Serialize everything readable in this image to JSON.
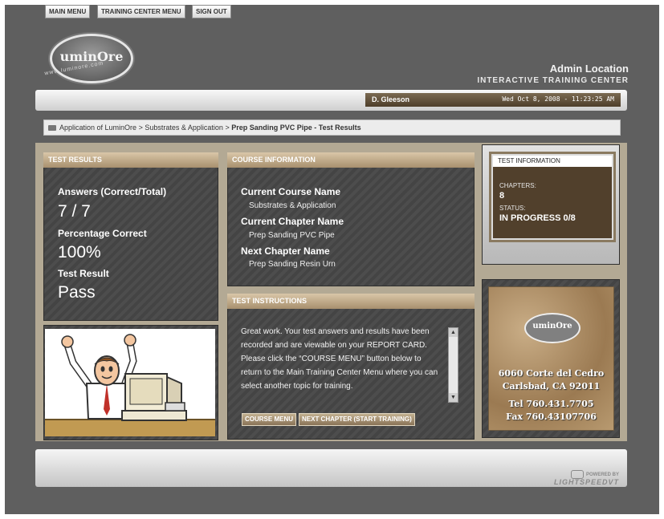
{
  "header": {
    "logo_text": "uminOre",
    "logo_url": "www.luminore.com",
    "location": "Admin Location",
    "subtitle": "INTERACTIVE TRAINING CENTER"
  },
  "nav": {
    "buttons": [
      "MAIN MENU",
      "TRAINING CENTER MENU",
      "SIGN OUT"
    ]
  },
  "user": {
    "name": "D. Gleeson",
    "datetime": "Wed Oct 8, 2008 - 11:23:25 AM"
  },
  "breadcrumb": {
    "part1": "Application of LuminOre",
    "part2": "Substrates & Application",
    "current": "Prep Sanding PVC Pipe - Test Results",
    "separator": ">"
  },
  "test_results": {
    "header": "TEST RESULTS",
    "answers_label": "Answers (Correct/Total)",
    "answers_value": "7 / 7",
    "percentage_label": "Percentage Correct",
    "percentage_value": "100%",
    "result_label": "Test Result",
    "result_value": "Pass"
  },
  "course_info": {
    "header": "COURSE INFORMATION",
    "current_course_label": "Current Course Name",
    "current_course_value": "Substrates & Application",
    "current_chapter_label": "Current Chapter Name",
    "current_chapter_value": "Prep Sanding PVC Pipe",
    "next_chapter_label": "Next Chapter Name",
    "next_chapter_value": "Prep Sanding Resin Urn"
  },
  "test_info": {
    "title": "TEST INFORMATION",
    "chapters_label": "CHAPTERS:",
    "chapters_value": "8",
    "status_label": "STATUS:",
    "status_value": "IN PROGRESS 0/8"
  },
  "instructions": {
    "header": "TEST INSTRUCTIONS",
    "text": "Great work. Your test answers and results have been recorded and are viewable on your REPORT CARD. Please click the “COURSE MENU” button below to return to the Main Training Center Menu where you can select another topic for training.",
    "course_menu_button": "COURSE MENU",
    "next_chapter_button": "NEXT CHAPTER (START TRAINING)"
  },
  "address": {
    "logo_text": "uminOre",
    "line1": "6060 Corte del Cedro",
    "line2": "Carlsbad, CA 92011",
    "tel": "Tel 760.431.7705",
    "fax": "Fax 760.43107706"
  },
  "footer": {
    "powered_by": "POWERED BY",
    "brand": "LIGHTSPEEDVT"
  },
  "colors": {
    "frame": "#5f5f5f",
    "panel_header": "#c7b291",
    "content_bg": "#b3a994",
    "userbar": "#5e4e38"
  },
  "icons": [
    "folder-icon",
    "scroll-up-icon",
    "scroll-down-icon",
    "lightspeed-logo-icon"
  ]
}
